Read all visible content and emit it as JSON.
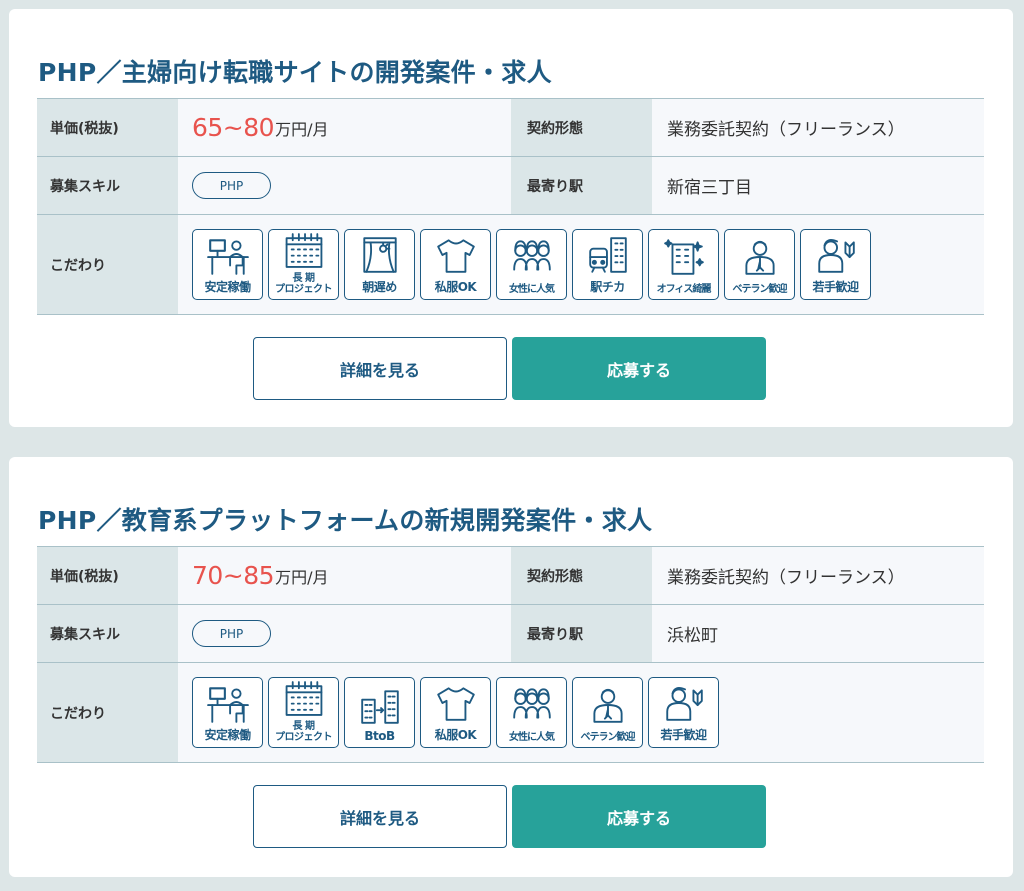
{
  "labels": {
    "price": "単価(税抜)",
    "contract": "契約形態",
    "skills": "募集スキル",
    "station": "最寄り駅",
    "features": "こだわり",
    "detail_button": "詳細を見る",
    "apply_button": "応募する",
    "unit": "万円/月"
  },
  "jobs": [
    {
      "title": "PHP／主婦向け転職サイトの開発案件・求人",
      "price_range": "65~80",
      "contract_type": "業務委託契約（フリーランス）",
      "skill": "PHP",
      "station": "新宿三丁目",
      "tags": [
        {
          "label": "安定稼働",
          "icon": "desk-worker-icon"
        },
        {
          "label": "長 期\nプロジェクト",
          "icon": "calendar-icon"
        },
        {
          "label": "朝遅め",
          "icon": "window-sun-icon"
        },
        {
          "label": "私服OK",
          "icon": "tshirt-icon"
        },
        {
          "label": "女性に人気",
          "icon": "women-group-icon"
        },
        {
          "label": "駅チカ",
          "icon": "train-station-icon"
        },
        {
          "label": "オフィス綺麗",
          "icon": "clean-office-icon"
        },
        {
          "label": "ベテラン歓迎",
          "icon": "veteran-icon"
        },
        {
          "label": "若手歓迎",
          "icon": "young-beginner-icon"
        }
      ]
    },
    {
      "title": "PHP／教育系プラットフォームの新規開発案件・求人",
      "price_range": "70~85",
      "contract_type": "業務委託契約（フリーランス）",
      "skill": "PHP",
      "station": "浜松町",
      "tags": [
        {
          "label": "安定稼働",
          "icon": "desk-worker-icon"
        },
        {
          "label": "長 期\nプロジェクト",
          "icon": "calendar-icon"
        },
        {
          "label": "BtoB",
          "icon": "btob-buildings-icon"
        },
        {
          "label": "私服OK",
          "icon": "tshirt-icon"
        },
        {
          "label": "女性に人気",
          "icon": "women-group-icon"
        },
        {
          "label": "ベテラン歓迎",
          "icon": "veteran-icon"
        },
        {
          "label": "若手歓迎",
          "icon": "young-beginner-icon"
        }
      ]
    }
  ],
  "colors": {
    "title": "#1e5a82",
    "price": "#e8534d",
    "apply": "#27a29a",
    "header_cell": "#dbe6e8",
    "background": "#dde6e7"
  }
}
